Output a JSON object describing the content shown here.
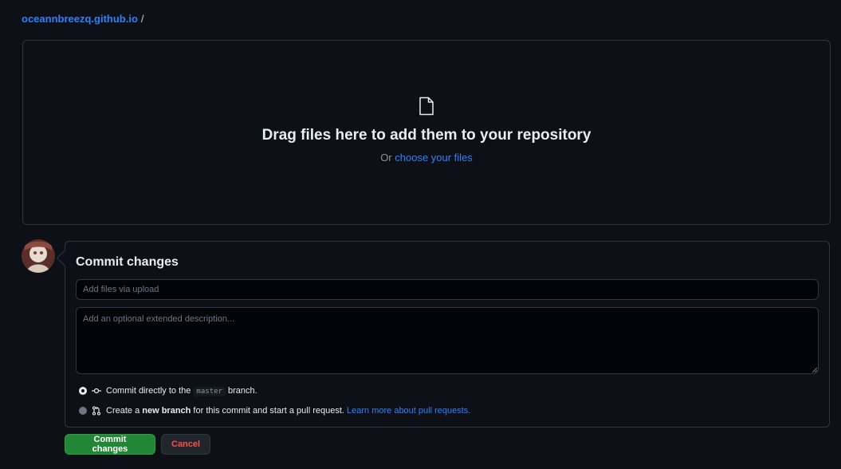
{
  "breadcrumb": {
    "repo": "oceannbreezq.github.io",
    "separator": "/"
  },
  "dropzone": {
    "icon": "file-icon",
    "title": "Drag files here to add them to your repository",
    "sub_prefix": "Or ",
    "sub_link": "choose your files"
  },
  "commit": {
    "title": "Commit changes",
    "summary_placeholder": "Add files via upload",
    "summary_value": "",
    "description_placeholder": "Add an optional extended description...",
    "description_value": "",
    "option_direct": {
      "prefix": "Commit directly to the ",
      "branch": "master",
      "suffix": " branch.",
      "selected": true,
      "icon": "git-commit-icon"
    },
    "option_new_branch": {
      "prefix": "Create a ",
      "bold": "new branch",
      "middle": " for this commit and start a pull request. ",
      "link": "Learn more about pull requests.",
      "selected": false,
      "icon": "git-pull-request-icon"
    }
  },
  "buttons": {
    "commit": "Commit changes",
    "cancel": "Cancel"
  },
  "colors": {
    "background": "#0d1117",
    "border": "#30363d",
    "link": "#2f81f7",
    "primary_button": "#238636",
    "danger_text": "#f85149"
  }
}
